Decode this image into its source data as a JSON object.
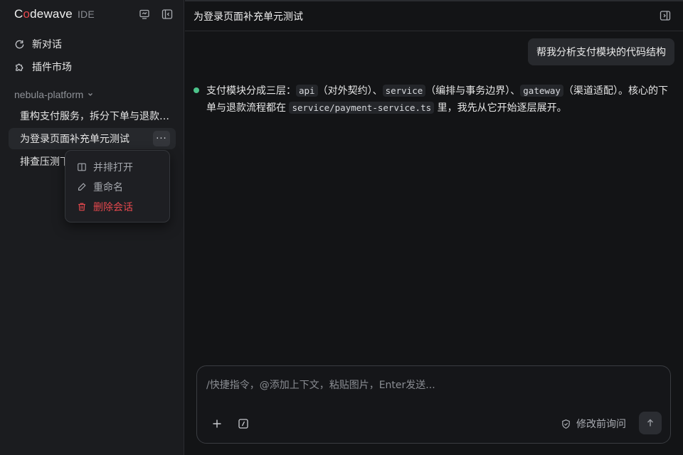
{
  "app": {
    "logo_prefix": "C",
    "logo_o": "o",
    "logo_rest": "dewave",
    "logo_suffix": "IDE"
  },
  "sidebar": {
    "icons": [
      "monitor-chat-icon",
      "collapse-sidebar-icon"
    ],
    "nav": [
      {
        "label": "新对话",
        "icon": "new-chat-icon"
      },
      {
        "label": "插件市场",
        "icon": "puzzle-icon"
      }
    ],
    "project": "nebula-platform",
    "conversations": [
      {
        "label": "重构支付服务，拆分下单与退款流程"
      },
      {
        "label": "为登录页面补充单元测试"
      },
      {
        "label": "排查压测下"
      }
    ],
    "more_label": "···"
  },
  "context_menu": {
    "items": [
      {
        "label": "并排打开",
        "icon": "split-view-icon"
      },
      {
        "label": "重命名",
        "icon": "pencil-icon"
      },
      {
        "label": "删除会话",
        "icon": "trash-icon"
      }
    ]
  },
  "topbar": {
    "title": "为登录页面补充单元测试"
  },
  "chat": {
    "user_message": "帮我分析支付模块的代码结构",
    "assistant": {
      "p1": "支付模块分成三层：",
      "c1": "api",
      "p2": "（对外契约）、",
      "c2": "service",
      "p3": "（编排与事务边界）、",
      "c3": "gateway",
      "p4": "（渠道适配）。核心的下单与退款流程都在",
      "c4": "service/payment-service.ts",
      "p5": "里，我先从它开始逐层展开。"
    }
  },
  "composer": {
    "placeholder": "/快捷指令，@添加上下文，粘贴图片，Enter发送...",
    "mode_label": "修改前询问"
  },
  "colors": {
    "accent_danger": "#e5484d",
    "status_ok": "#4cc38a",
    "background": "#131416",
    "sidebar": "#1b1c1f"
  }
}
